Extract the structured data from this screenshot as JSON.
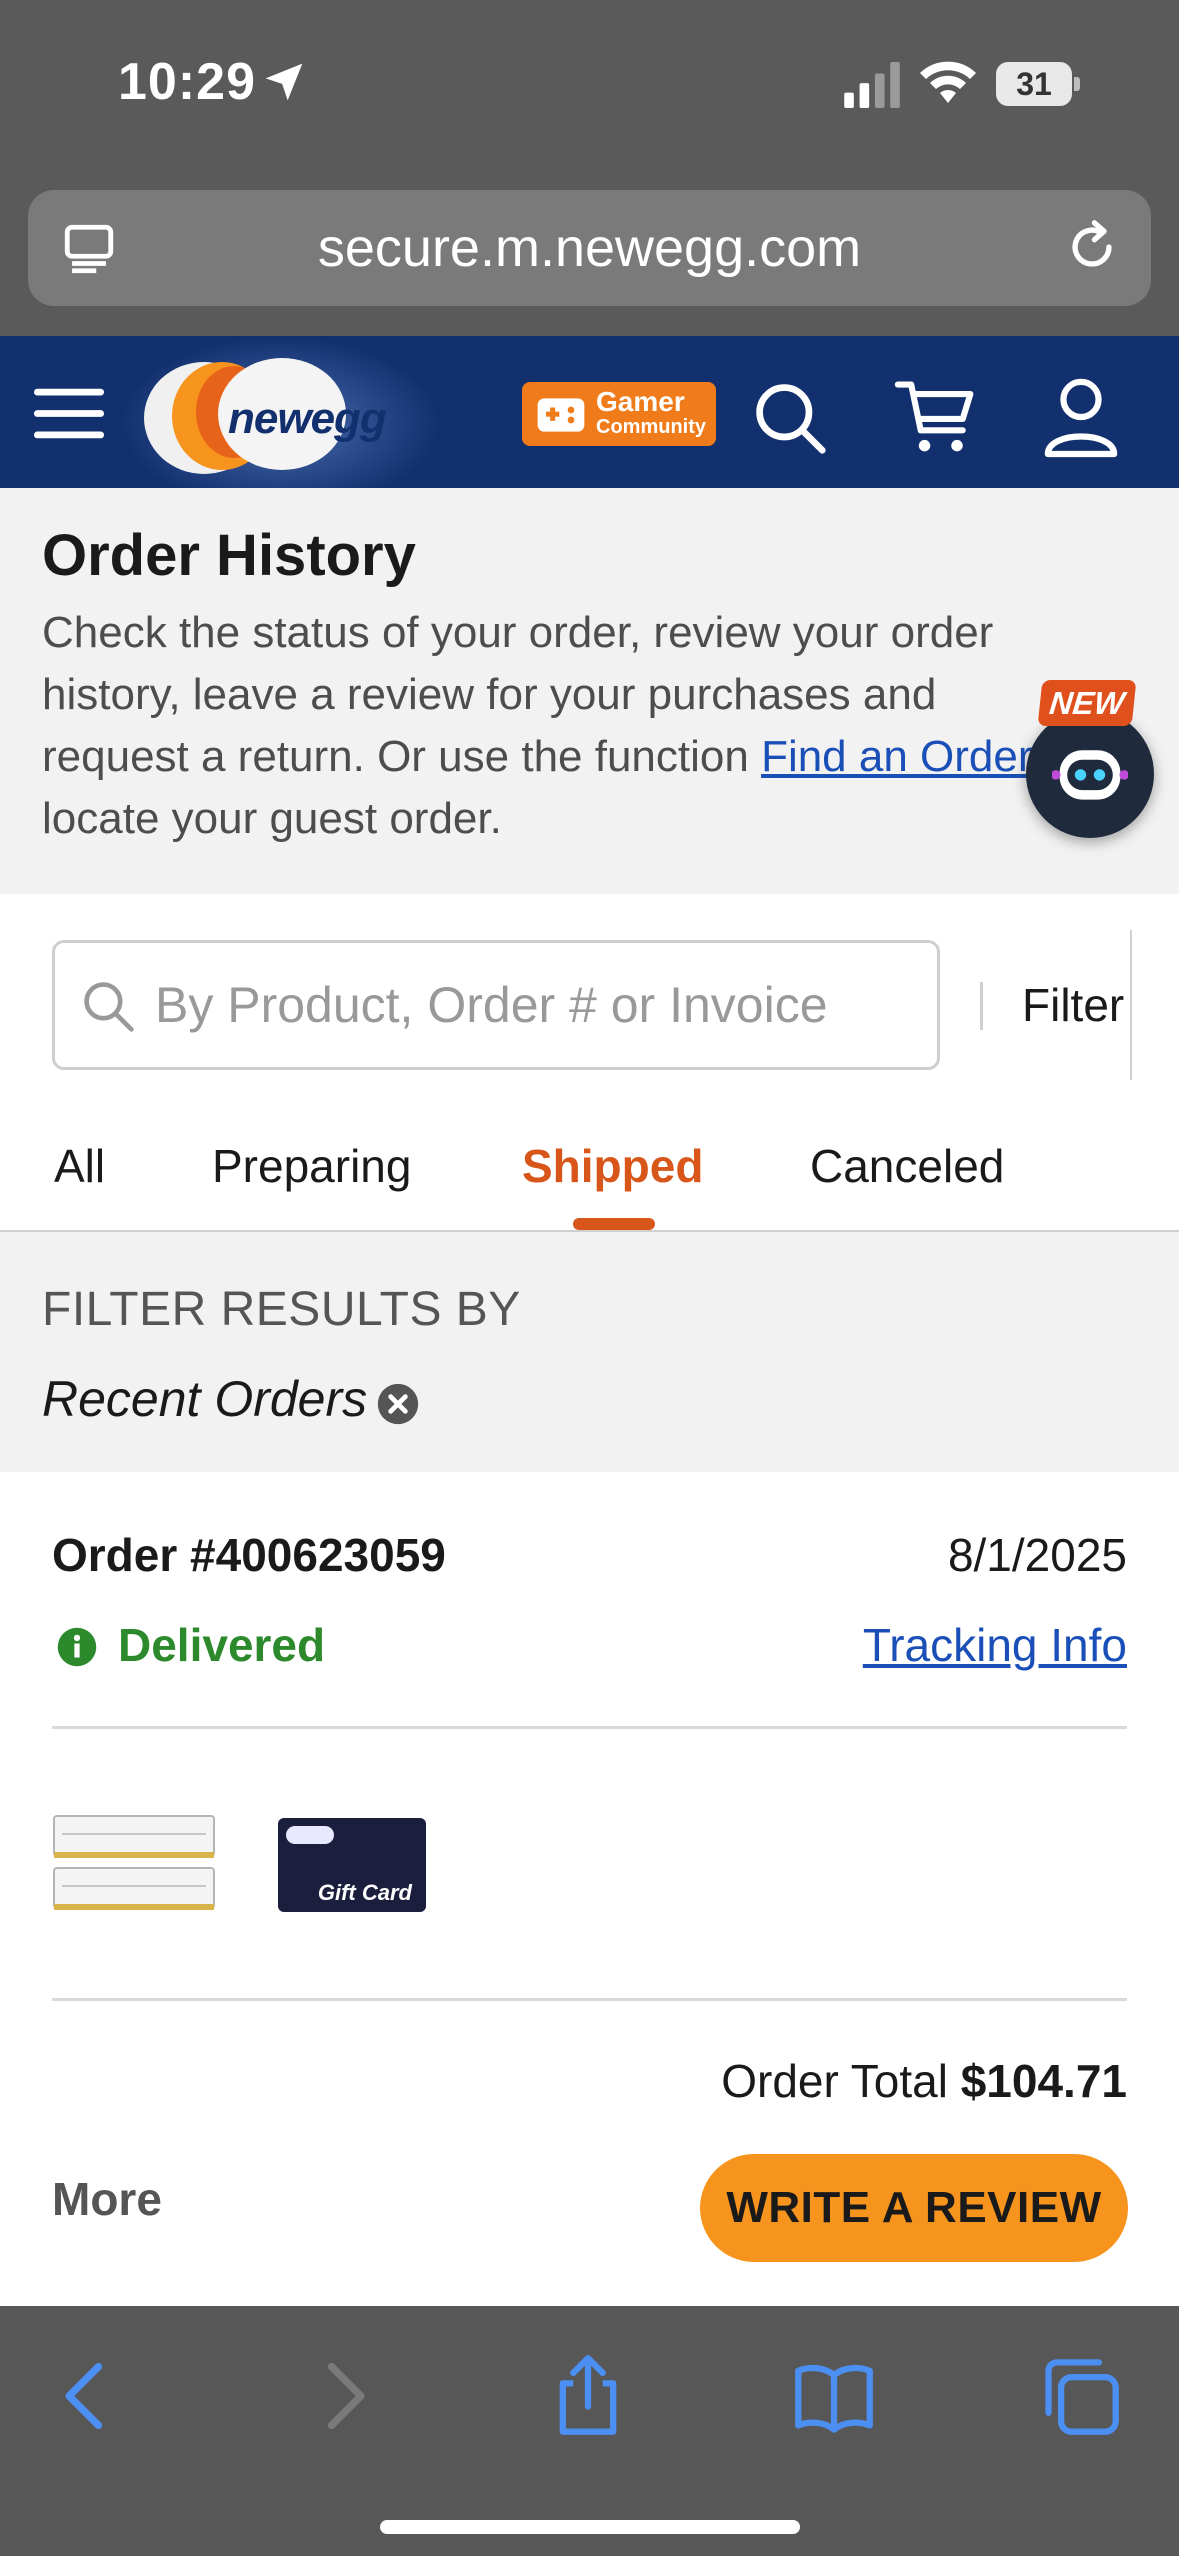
{
  "status_bar": {
    "time": "10:29",
    "battery": "31"
  },
  "browser": {
    "url": "secure.m.newegg.com"
  },
  "header": {
    "logo_text": "newegg",
    "gamer_badge_line1": "Gamer",
    "gamer_badge_line2": "Community"
  },
  "intro": {
    "title": "Order History",
    "description_before_link": "Check the status of your order, review your order history, leave a review for your purchases and request a return. Or use the function ",
    "link_text": "Find an Order",
    "description_after_link": " to locate your guest order."
  },
  "assistant": {
    "badge": "NEW"
  },
  "search": {
    "placeholder": "By Product, Order # or Invoice",
    "filter_label": "Filter"
  },
  "tabs": [
    {
      "label": "All",
      "active": false
    },
    {
      "label": "Preparing",
      "active": false
    },
    {
      "label": "Shipped",
      "active": true
    },
    {
      "label": "Canceled",
      "active": false
    }
  ],
  "filter_results": {
    "heading": "FILTER RESULTS BY",
    "chip": "Recent Orders"
  },
  "order": {
    "number": "Order #400623059",
    "date": "8/1/2025",
    "status": "Delivered",
    "tracking_label": "Tracking Info",
    "gift_card_label": "Gift Card",
    "total_label": "Order Total",
    "total_value": "$104.71",
    "more_label": "More",
    "review_button": "WRITE A REVIEW"
  },
  "colors": {
    "header_bg": "#13306e",
    "accent_orange": "#d8561a",
    "review_button": "#f7941d",
    "delivered_green": "#2c8a2c",
    "link_blue": "#1b4fb8"
  }
}
